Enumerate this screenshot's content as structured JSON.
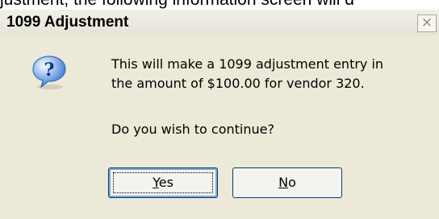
{
  "background": {
    "text": "justment, the following information screen will d"
  },
  "dialog": {
    "title": "1099 Adjustment",
    "close_glyph": "×",
    "icon": "question-icon",
    "message_line1": "This will make a 1099 adjustment entry in",
    "message_line2": "the amount of $100.00 for vendor 320.",
    "question": "Do you wish to continue?",
    "yes_accel": "Y",
    "yes_rest": "es",
    "no_accel": "N",
    "no_rest": "o"
  },
  "colors": {
    "dialog_bg": "#ece9d8",
    "button_border": "#003c74",
    "icon_blue": "#2f6fd0"
  }
}
